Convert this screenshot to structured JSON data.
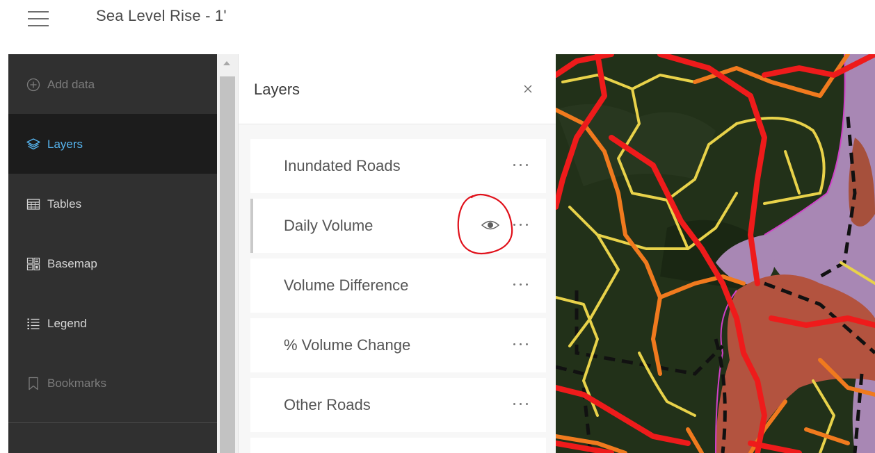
{
  "app": {
    "title": "Sea Level Rise - 1'"
  },
  "sidebar": {
    "items": [
      {
        "label": "Add data",
        "icon": "add-circle-icon",
        "state": "disabled"
      },
      {
        "label": "Layers",
        "icon": "layers-icon",
        "state": "active"
      },
      {
        "label": "Tables",
        "icon": "table-icon",
        "state": "normal"
      },
      {
        "label": "Basemap",
        "icon": "basemap-icon",
        "state": "normal"
      },
      {
        "label": "Legend",
        "icon": "legend-icon",
        "state": "normal"
      },
      {
        "label": "Bookmarks",
        "icon": "bookmark-icon",
        "state": "disabled"
      }
    ]
  },
  "panel": {
    "title": "Layers",
    "layers": [
      {
        "name": "Inundated Roads"
      },
      {
        "name": "Daily Volume",
        "hovered": true,
        "visibility_icon": "eye-icon"
      },
      {
        "name": "Volume Difference"
      },
      {
        "name": "% Volume Change"
      },
      {
        "name": "Other Roads"
      }
    ]
  },
  "colors": {
    "sidebar_bg": "#303030",
    "active_item_bg": "#1c1c1c",
    "accent": "#56b5f0",
    "annotation": "#e0101a"
  }
}
